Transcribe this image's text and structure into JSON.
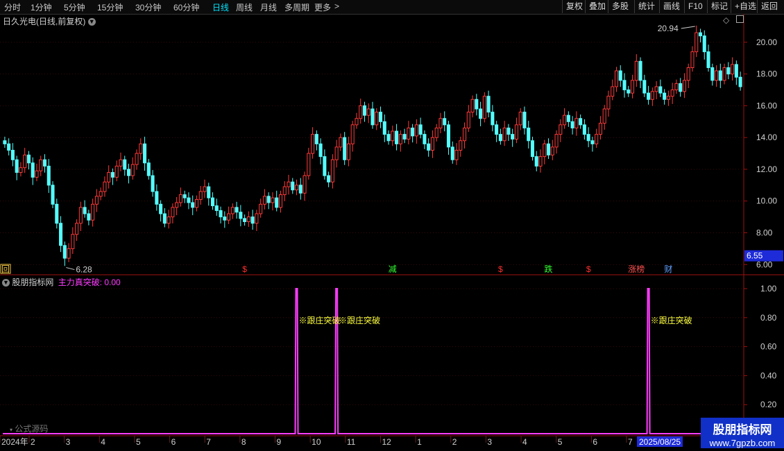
{
  "toolbar": {
    "periods": [
      "分时",
      "1分钟",
      "5分钟",
      "15分钟",
      "30分钟",
      "60分钟",
      "日线",
      "周线",
      "月线",
      "多周期",
      "更多"
    ],
    "active_period": "日线",
    "more_arrow": ">",
    "buttons": [
      "复权",
      "叠加",
      "多股",
      "统计",
      "画线",
      "F10",
      "标记",
      "+自选",
      "返回"
    ]
  },
  "price_panel": {
    "title": "日久光电(日线,前复权)",
    "dropdown_icon": "chevron-down-icon",
    "y_ticks": [
      "20.00",
      "18.00",
      "16.00",
      "14.00",
      "12.00",
      "10.00",
      "8.00",
      "6.00"
    ],
    "y_range": [
      5.4,
      21.0
    ],
    "current_price_box": "6.55",
    "high_label": "20.94",
    "low_label": "6.28",
    "event_markers": [
      {
        "text": "回",
        "color": "#f5c842",
        "boxed": true,
        "bar": 0
      },
      {
        "text": "$",
        "color": "#ff3030",
        "bar": 60
      },
      {
        "text": "减",
        "color": "#30ff30",
        "bar": 97
      },
      {
        "text": "$",
        "color": "#ff3030",
        "bar": 124
      },
      {
        "text": "跌",
        "color": "#30ff30",
        "bar": 136
      },
      {
        "text": "$",
        "color": "#ff3030",
        "bar": 146
      },
      {
        "text": "涨榜",
        "color": "#ff5050",
        "bar": 158
      },
      {
        "text": "财",
        "color": "#60a0ff",
        "bar": 166
      }
    ]
  },
  "indicator_panel": {
    "name": "股朋指标网",
    "series_label": "主力真突破: 0.00",
    "y_ticks": [
      "1.00",
      "0.80",
      "0.60",
      "0.40",
      "0.20"
    ],
    "y_range": [
      0,
      1.0
    ],
    "signal_text": "※跟庄突破",
    "signal_bars": [
      73,
      83,
      161
    ],
    "formula_link": "公式源码"
  },
  "time_axis": {
    "labels": [
      "2024年",
      "2",
      "3",
      "4",
      "5",
      "6",
      "7",
      "8",
      "9",
      "10",
      "11",
      "12",
      "1",
      "2",
      "3",
      "4",
      "5",
      "6",
      "7"
    ],
    "cursor_date": "2025/08/25"
  },
  "watermark": {
    "line1": "股朋指标网",
    "line2": "www.7gpzb.com"
  },
  "colors": {
    "up": "#ff3b3b",
    "down": "#54ffff",
    "axis": "#a01010",
    "signal": "#ff3cff",
    "signal_text": "#ffff40",
    "active_tab": "#00e5ff"
  },
  "chart_data": {
    "type": "line",
    "title": "日久光电(日线,前复权)",
    "series": [
      {
        "name": "主力真突破",
        "x": [
          "2024-01",
          "2024-09",
          "2024-10",
          "2025-06"
        ],
        "y": [
          0,
          1,
          1,
          1
        ]
      }
    ],
    "price_close": [
      13.6,
      13.2,
      12.6,
      11.8,
      12.1,
      12.9,
      12.4,
      11.5,
      11.9,
      12.6,
      12.2,
      11.0,
      9.8,
      8.6,
      7.2,
      6.4,
      7.0,
      7.9,
      8.6,
      9.6,
      9.2,
      8.8,
      9.8,
      10.3,
      10.6,
      11.2,
      11.8,
      11.5,
      12.2,
      12.6,
      12.0,
      11.6,
      12.3,
      13.0,
      13.6,
      12.4,
      11.6,
      10.6,
      9.8,
      9.2,
      8.6,
      9.0,
      9.6,
      9.9,
      10.4,
      10.2,
      9.9,
      9.6,
      10.1,
      10.6,
      10.9,
      10.2,
      9.7,
      9.4,
      9.0,
      8.8,
      9.2,
      9.6,
      9.3,
      8.9,
      8.7,
      9.0,
      8.6,
      9.2,
      9.8,
      10.3,
      9.9,
      10.2,
      9.6,
      10.4,
      10.9,
      11.2,
      10.7,
      11.0,
      10.5,
      11.6,
      13.0,
      14.2,
      13.6,
      12.8,
      11.6,
      11.2,
      12.6,
      13.4,
      14.0,
      12.6,
      13.6,
      14.8,
      15.2,
      16.0,
      15.4,
      15.8,
      14.8,
      15.6,
      15.0,
      14.2,
      13.8,
      14.4,
      13.6,
      14.2,
      13.9,
      14.6,
      14.1,
      14.8,
      14.2,
      13.6,
      13.2,
      14.0,
      14.6,
      15.2,
      14.8,
      13.4,
      12.6,
      13.2,
      13.8,
      14.6,
      15.6,
      16.4,
      15.8,
      15.2,
      16.6,
      15.6,
      14.8,
      14.2,
      13.8,
      14.6,
      14.2,
      13.9,
      14.8,
      15.6,
      14.6,
      13.8,
      12.8,
      12.2,
      12.8,
      13.6,
      12.9,
      13.4,
      14.2,
      14.8,
      15.4,
      15.0,
      14.6,
      15.2,
      14.8,
      14.2,
      13.8,
      13.6,
      14.2,
      14.9,
      15.8,
      16.6,
      17.2,
      18.2,
      17.6,
      17.0,
      16.8,
      17.6,
      18.8,
      17.6,
      16.8,
      16.4,
      16.9,
      17.2,
      16.8,
      16.4,
      16.6,
      17.0,
      17.4,
      16.9,
      17.6,
      18.4,
      19.4,
      20.6,
      20.4,
      19.4,
      18.4,
      17.6,
      18.2,
      17.6,
      18.4,
      18.0,
      18.6,
      17.8,
      17.2
    ]
  }
}
